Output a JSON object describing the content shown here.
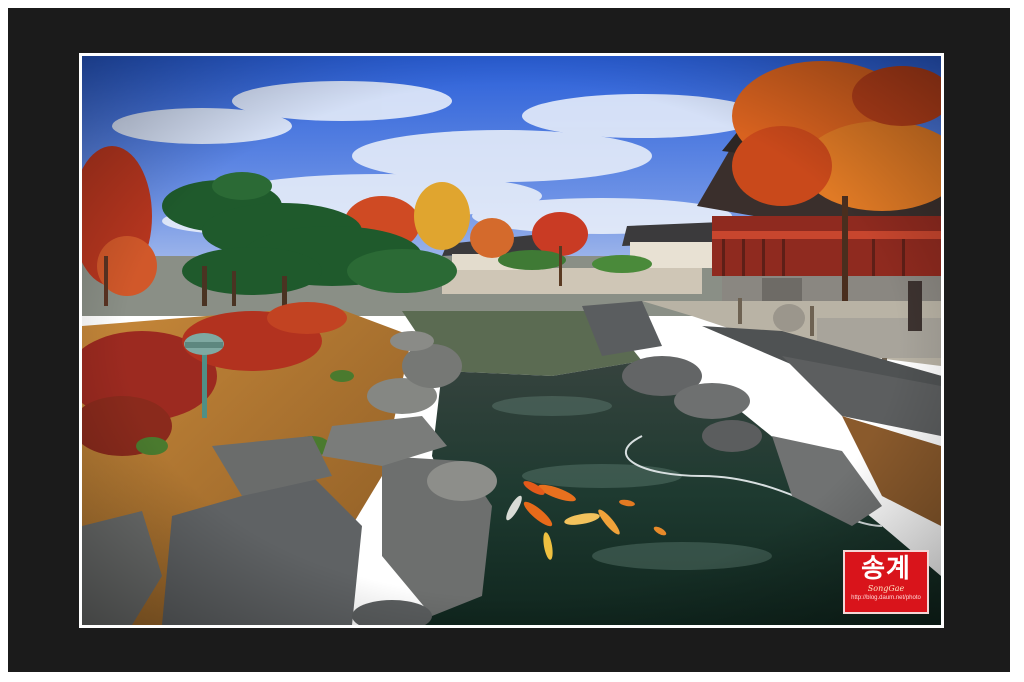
{
  "watermark": {
    "title": "송계",
    "subtitle": "SongGae",
    "url": "http://blog.daum.net/photo"
  },
  "colors": {
    "frame": "#1b1b1b",
    "sky": "#3e6fe0",
    "foliage_red": "#c0442a",
    "foliage_orange": "#e5862c",
    "pine": "#1f5a2c",
    "water": "#17302a",
    "watermark": "#d9141b"
  },
  "scene": {
    "koi_count": 9,
    "elements": [
      "garden-lamp",
      "koi-pond",
      "hanok-pavilion",
      "autumn-trees",
      "stone-edging",
      "stone-jar"
    ]
  }
}
